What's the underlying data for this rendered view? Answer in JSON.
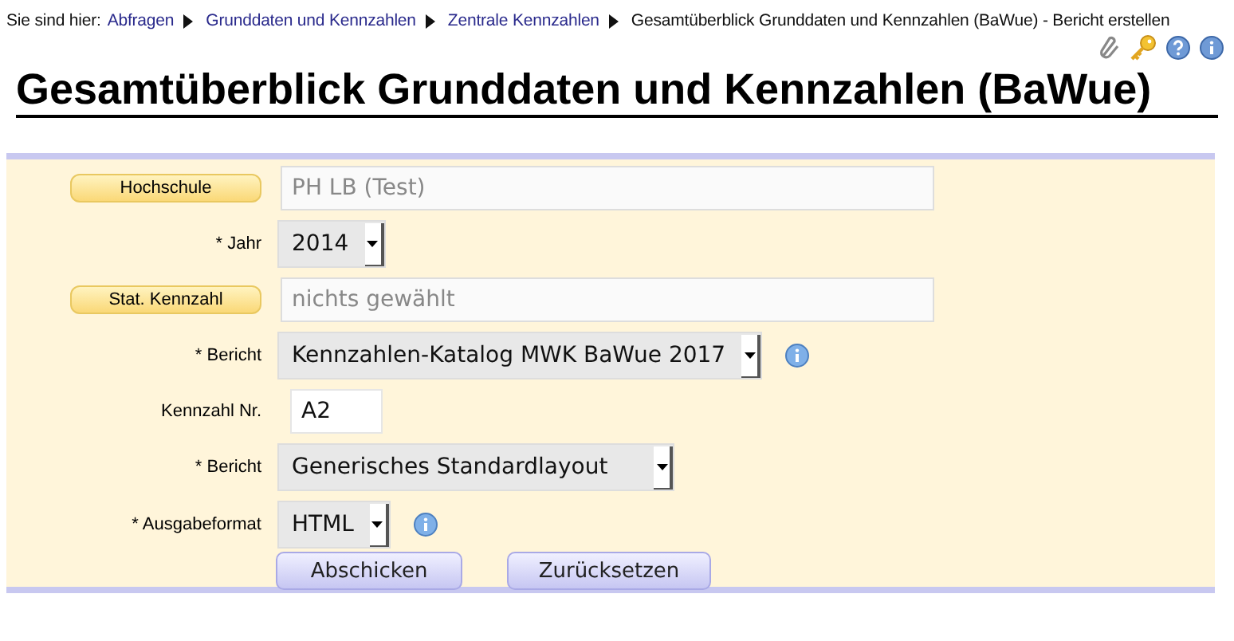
{
  "breadcrumb": {
    "prefix": "Sie sind hier:",
    "links": [
      "Abfragen",
      "Grunddaten und Kennzahlen",
      "Zentrale Kennzahlen"
    ],
    "current": "Gesamtüberblick Grunddaten und Kennzahlen (BaWue) - Bericht erstellen"
  },
  "title": "Gesamtüberblick Grunddaten und Kennzahlen (BaWue)",
  "form": {
    "rows": [
      {
        "kind": "lookup",
        "label": "Hochschule",
        "placeholder": "PH LB (Test)"
      },
      {
        "kind": "select",
        "label": "* Jahr",
        "value": "2014",
        "info": false
      },
      {
        "kind": "lookup",
        "label": "Stat. Kennzahl",
        "placeholder": "nichts gewählt"
      },
      {
        "kind": "select",
        "label": "* Bericht",
        "value": "Kennzahlen-Katalog MWK BaWue 2017",
        "info": true
      },
      {
        "kind": "text",
        "label": "Kennzahl Nr.",
        "value": "A2"
      },
      {
        "kind": "select",
        "label": "* Bericht",
        "value": "Generisches Standardlayout",
        "info": false,
        "wide": true
      },
      {
        "kind": "select",
        "label": "* Ausgabeformat",
        "value": "HTML",
        "info": true
      }
    ],
    "buttons": [
      "Abschicken",
      "Zurücksetzen"
    ]
  }
}
